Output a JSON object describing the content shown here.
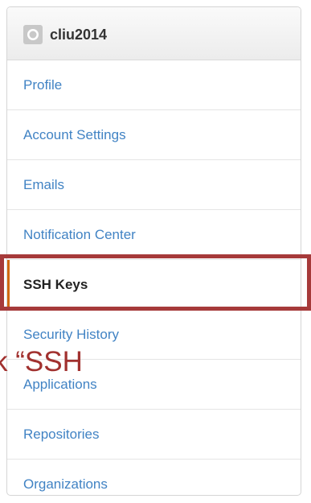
{
  "header": {
    "username": "cliu2014",
    "avatar_icon": "github-octocat-icon"
  },
  "menu": {
    "items": [
      {
        "label": "Profile",
        "selected": false
      },
      {
        "label": "Account Settings",
        "selected": false
      },
      {
        "label": "Emails",
        "selected": false
      },
      {
        "label": "Notification Center",
        "selected": false
      },
      {
        "label": "SSH Keys",
        "selected": true
      },
      {
        "label": "Security History",
        "selected": false
      },
      {
        "label": "Applications",
        "selected": false
      },
      {
        "label": "Repositories",
        "selected": false
      },
      {
        "label": "Organizations",
        "selected": false
      }
    ]
  },
  "annotation": {
    "caption": "k “SSH",
    "color": "#a1312f"
  },
  "colors": {
    "link": "#4183c4",
    "selected_text": "#222222",
    "selected_accent": "#d26911",
    "highlight_border": "#a63a3a"
  }
}
